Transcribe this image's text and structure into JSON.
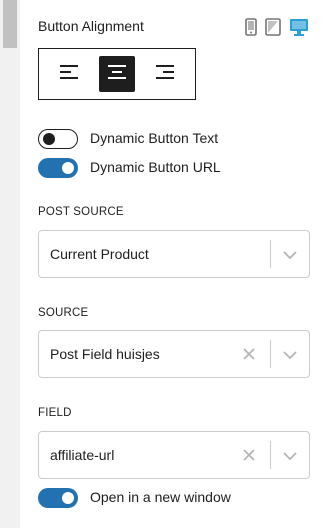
{
  "button_alignment": {
    "label": "Button Alignment",
    "devices": [
      "mobile-icon",
      "tablet-icon",
      "desktop-icon"
    ],
    "active_device": "desktop-icon",
    "options": [
      "align-left-icon",
      "align-center-icon",
      "align-right-icon"
    ],
    "active_option": "align-center-icon"
  },
  "toggles": {
    "dynamic_text": {
      "label": "Dynamic Button Text",
      "checked": false
    },
    "dynamic_url": {
      "label": "Dynamic Button URL",
      "checked": true
    },
    "new_window": {
      "label": "Open in a new window",
      "checked": true
    }
  },
  "post_source": {
    "label": "POST SOURCE",
    "value": "Current Product"
  },
  "source": {
    "label": "SOURCE",
    "value": "Post Field huisjes"
  },
  "field": {
    "label": "FIELD",
    "value": "affiliate-url"
  },
  "colors": {
    "accent": "#2271b1",
    "active_device": "#2a9fd8",
    "dark": "#1e1e1e",
    "border": "#cccccc"
  }
}
